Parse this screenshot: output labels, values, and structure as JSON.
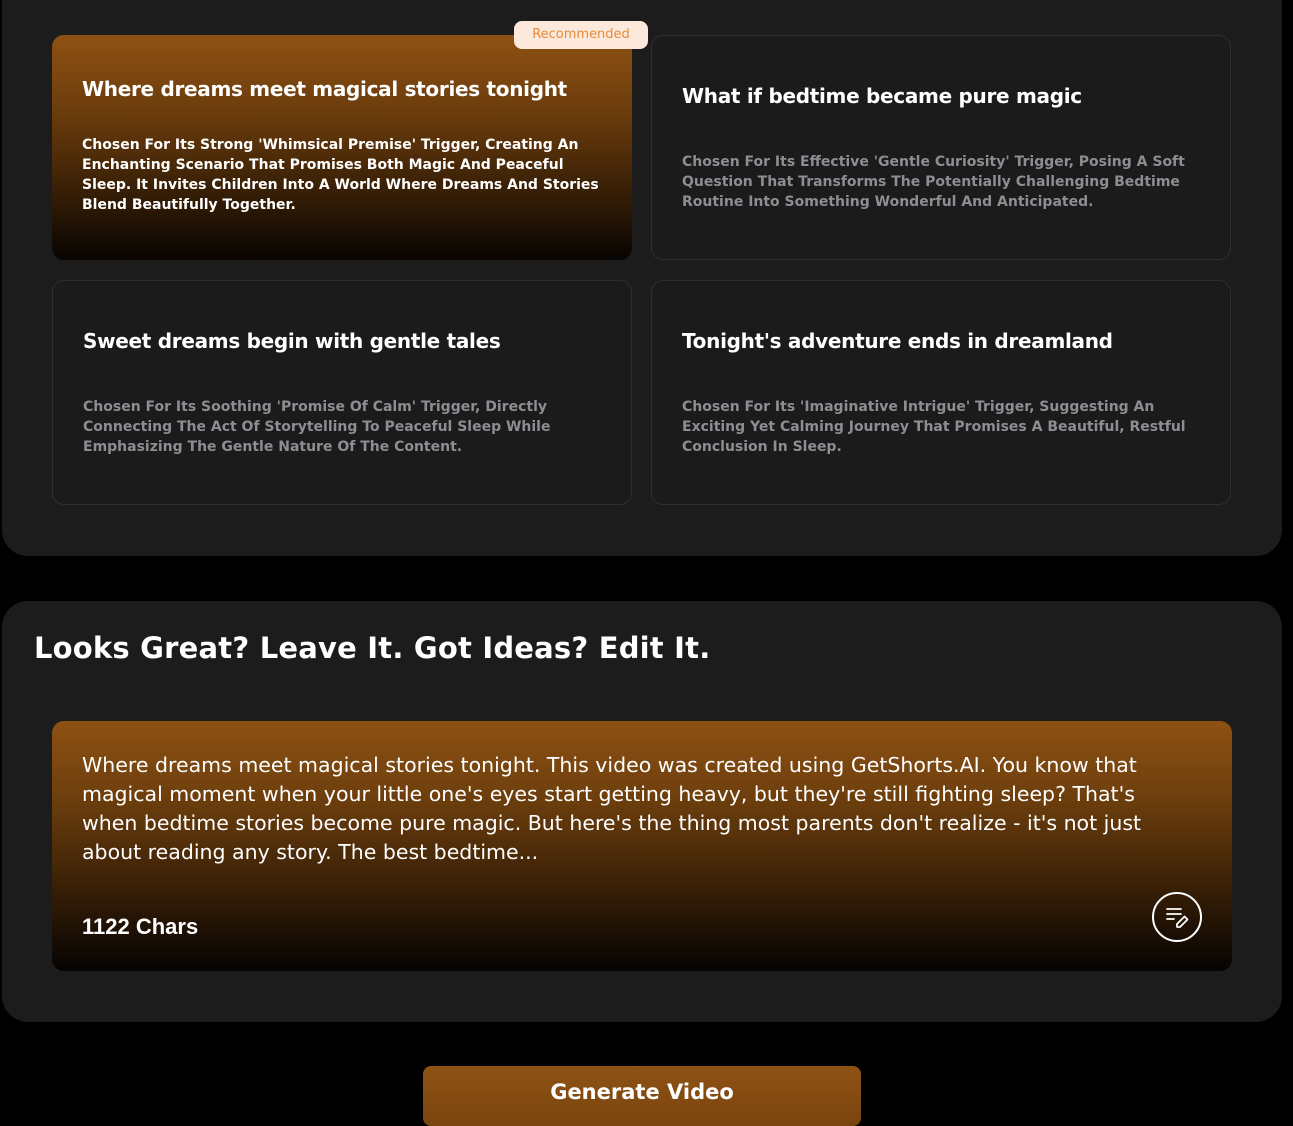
{
  "hooks": {
    "badge_label": "Recommended",
    "items": [
      {
        "title": "Where dreams meet magical stories tonight",
        "description": "Chosen For Its Strong 'Whimsical Premise' Trigger, Creating An Enchanting Scenario That Promises Both Magic And Peaceful Sleep. It Invites Children Into A World Where Dreams And Stories Blend Beautifully Together.",
        "selected": true
      },
      {
        "title": "What if bedtime became pure magic",
        "description": "Chosen For Its Effective 'Gentle Curiosity' Trigger, Posing A Soft Question That Transforms The Potentially Challenging Bedtime Routine Into Something Wonderful And Anticipated.",
        "selected": false
      },
      {
        "title": "Sweet dreams begin with gentle tales",
        "description": "Chosen For Its Soothing 'Promise Of Calm' Trigger, Directly Connecting The Act Of Storytelling To Peaceful Sleep While Emphasizing The Gentle Nature Of The Content.",
        "selected": false
      },
      {
        "title": "Tonight's adventure ends in dreamland",
        "description": "Chosen For Its 'Imaginative Intrigue' Trigger, Suggesting An Exciting Yet Calming Journey That Promises A Beautiful, Restful Conclusion In Sleep.",
        "selected": false
      }
    ]
  },
  "script": {
    "heading": "Looks Great? Leave It. Got Ideas? Edit It.",
    "text": "Where dreams meet magical stories tonight. This video was created using GetShorts.AI. You know that magical moment when your little one's eyes start getting heavy, but they're still fighting sleep? That's when bedtime stories become pure magic. But here's the thing most parents don't realize - it's not just about reading any story. The best bedtime...",
    "char_count": "1122 Chars",
    "edit_icon": "edit-script-icon"
  },
  "actions": {
    "generate_label": "Generate Video"
  },
  "colors": {
    "accent": "#8e5113",
    "panel": "#1c1c1d",
    "badge_bg": "#fde9dc",
    "badge_text": "#e68a3a"
  }
}
